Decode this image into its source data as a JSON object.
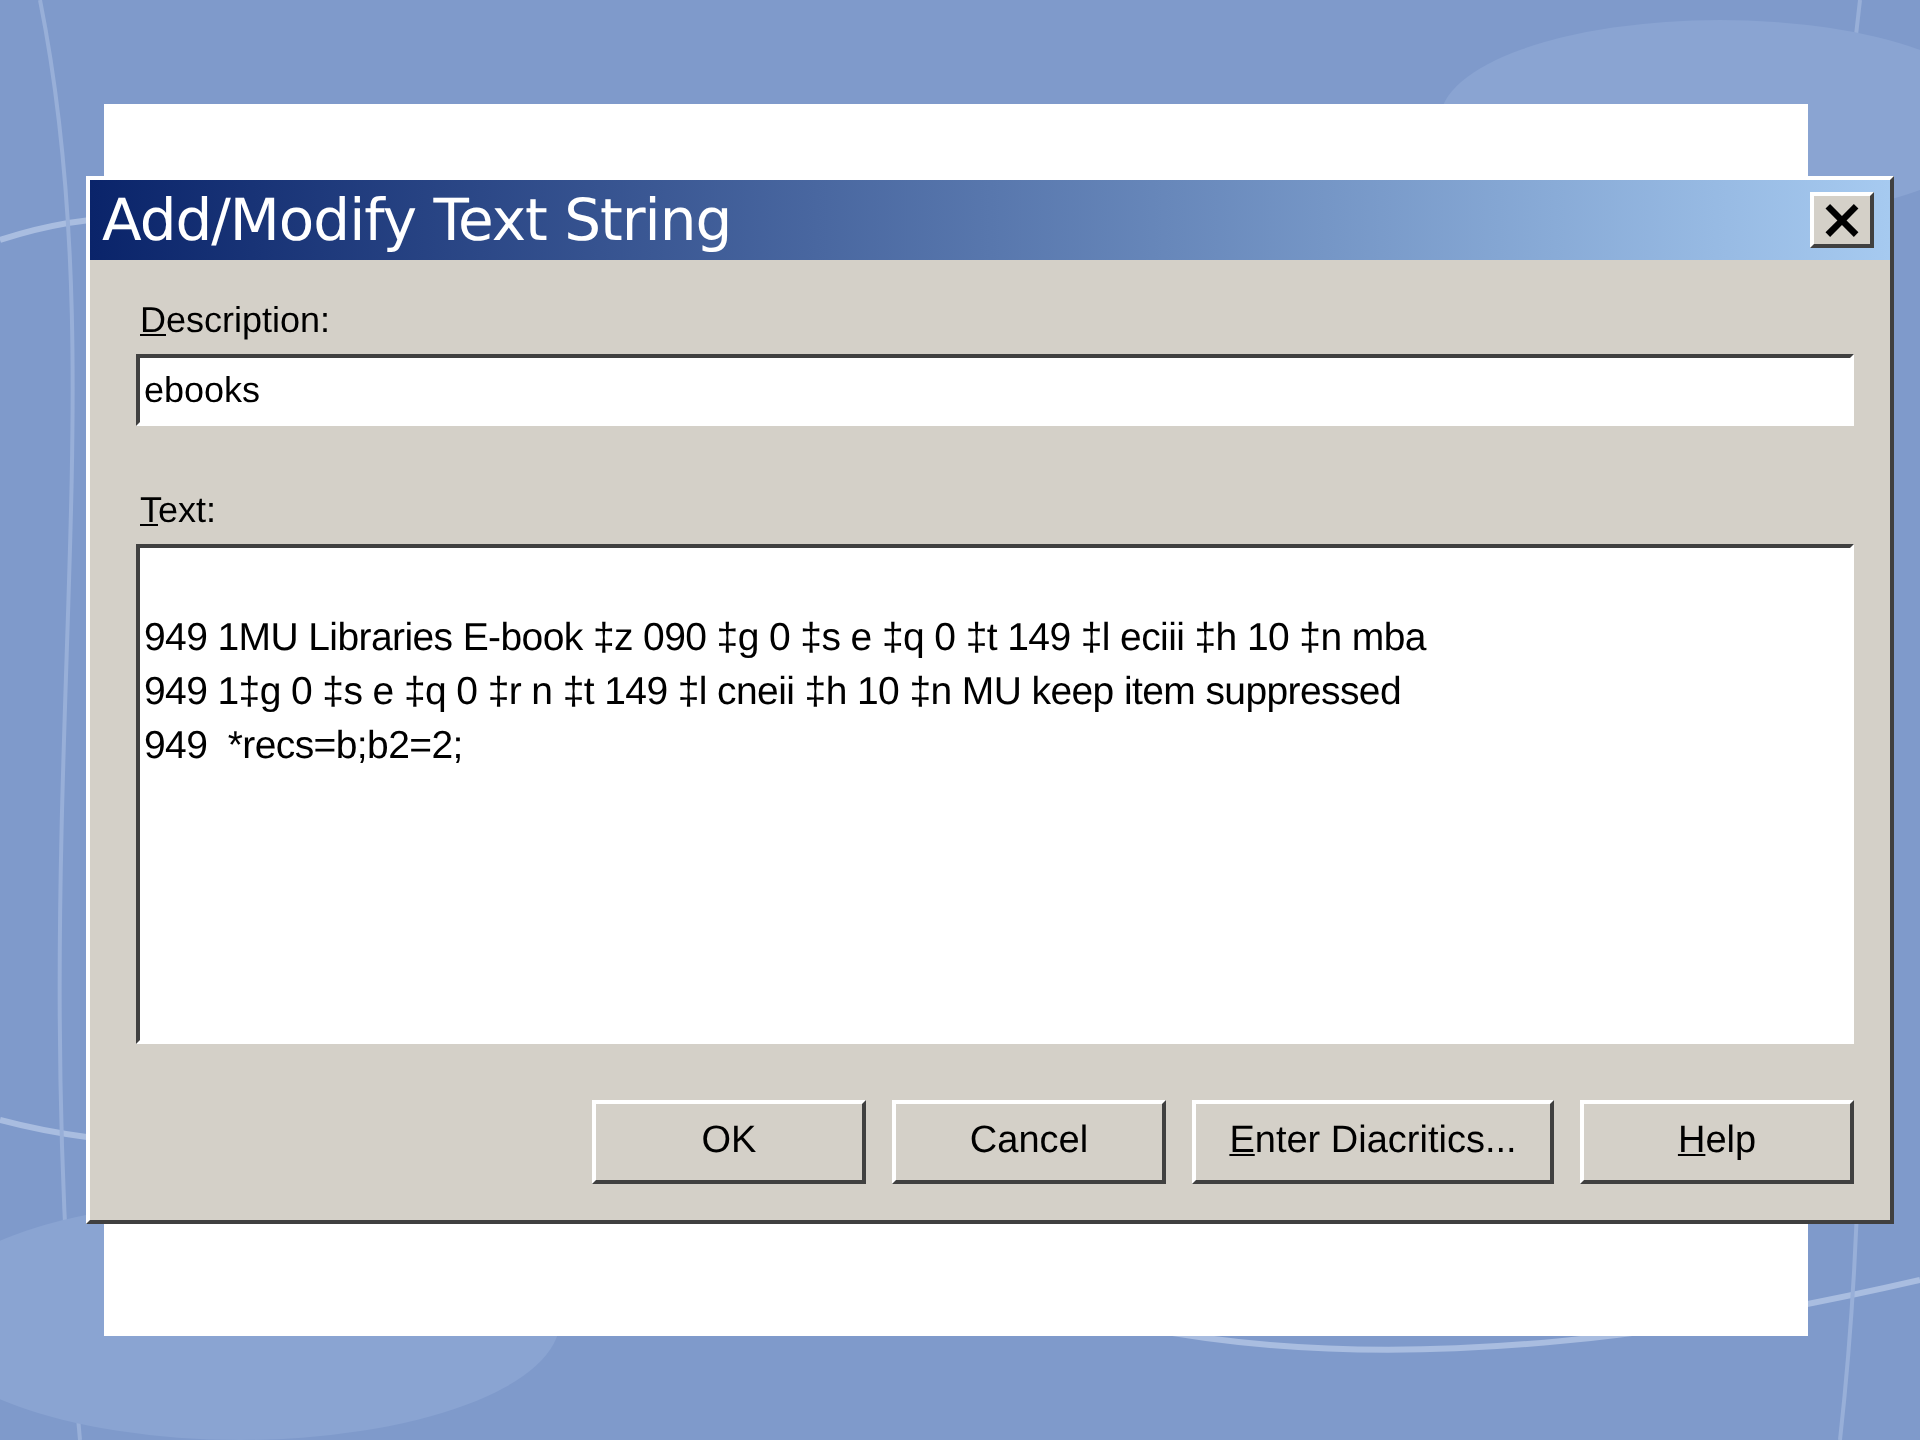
{
  "dialog": {
    "title": "Add/Modify Text String",
    "close": "×",
    "description": {
      "label": "Description:",
      "mnemonic": true,
      "value": "ebooks"
    },
    "text": {
      "label": "Text:",
      "mnemonic": true,
      "lines": [
        "949 1MU Libraries E-book ‡z 090 ‡g 0 ‡s e ‡q 0 ‡t 149 ‡l eciii ‡h 10 ‡n mba",
        "949 1‡g 0 ‡s e ‡q 0 ‡r n ‡t 149 ‡l cneii ‡h 10 ‡n MU keep item suppressed",
        "949  *recs=b;b2=2;"
      ]
    },
    "buttons": [
      {
        "label": "OK",
        "mnemonic": false
      },
      {
        "label": "Cancel",
        "mnemonic": false
      },
      {
        "label": "Enter Diacritics...",
        "mnemonic": true
      },
      {
        "label": "Help",
        "mnemonic": true
      }
    ]
  }
}
